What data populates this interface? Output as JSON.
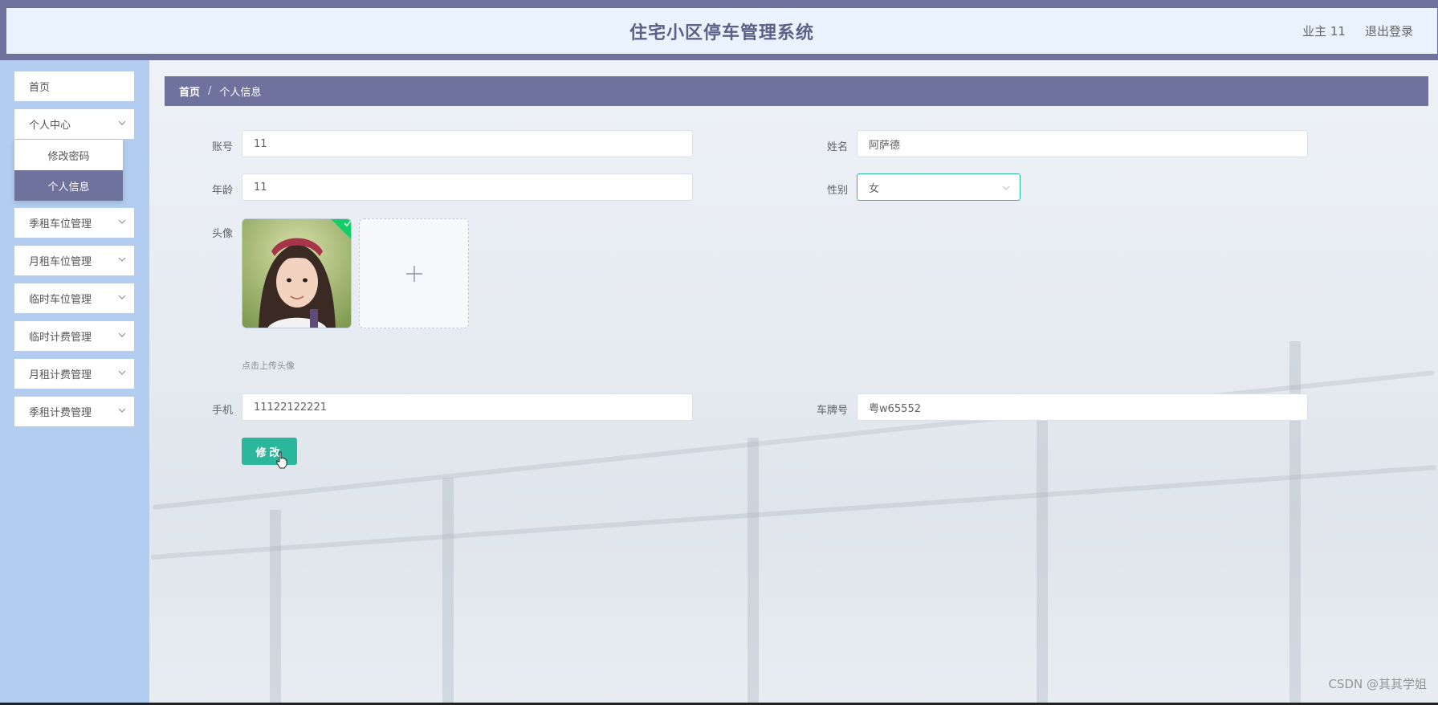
{
  "header": {
    "title": "住宅小区停车管理系统",
    "user": "业主 11",
    "logout": "退出登录"
  },
  "sidebar": {
    "items": [
      {
        "label": "首页"
      },
      {
        "label": "个人中心"
      },
      {
        "label": "季租车位管理"
      },
      {
        "label": "月租车位管理"
      },
      {
        "label": "临时车位管理"
      },
      {
        "label": "临时计费管理"
      },
      {
        "label": "月租计费管理"
      },
      {
        "label": "季租计费管理"
      }
    ],
    "submenu": [
      {
        "label": "修改密码"
      },
      {
        "label": "个人信息",
        "active": true
      }
    ]
  },
  "breadcrumb": {
    "home": "首页",
    "separator": "/",
    "current": "个人信息"
  },
  "form": {
    "account_label": "账号",
    "account_value": "11",
    "name_label": "姓名",
    "name_value": "阿萨德",
    "age_label": "年龄",
    "age_value": "11",
    "gender_label": "性别",
    "gender_value": "女",
    "avatar_label": "头像",
    "upload_hint": "点击上传头像",
    "phone_label": "手机",
    "phone_value": "11122122221",
    "plate_label": "车牌号",
    "plate_value": "粤w65552",
    "submit_label": "修改"
  },
  "watermark": "CSDN @其其学姐",
  "colors": {
    "accent": "#6e729d",
    "primary_button": "#2ab79b",
    "sidebar_bg": "#b2cdef",
    "header_bg": "#e8f3fd"
  }
}
